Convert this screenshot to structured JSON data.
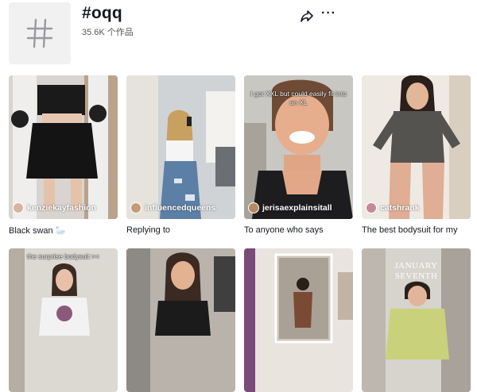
{
  "header": {
    "hashtag": "#oqq",
    "post_count": "35.6K 个作品",
    "share_icon": "share-icon",
    "more_icon": "more-icon"
  },
  "videos": [
    {
      "creator": "kenziekayfashion",
      "caption": "Black swan 🦢",
      "overlay": ""
    },
    {
      "creator": "influencedqueens",
      "caption": "Replying to",
      "overlay": ""
    },
    {
      "creator": "jerisaexplainsitall",
      "caption": "To anyone who says",
      "overlay": "I got XXL but could easily fit into an XL"
    },
    {
      "creator": "catshrank",
      "caption": "The best bodysuit for my",
      "overlay": ""
    },
    {
      "creator": "",
      "caption": "",
      "overlay": "the surprise bodysuit ><"
    },
    {
      "creator": "",
      "caption": "",
      "overlay": ""
    },
    {
      "creator": "",
      "caption": "",
      "overlay": ""
    },
    {
      "creator": "",
      "caption": "",
      "overlay": "JANUARY SEVENTH"
    }
  ],
  "colors": {
    "accent": "#161823",
    "placeholder_bg": "#f1f1f2"
  }
}
